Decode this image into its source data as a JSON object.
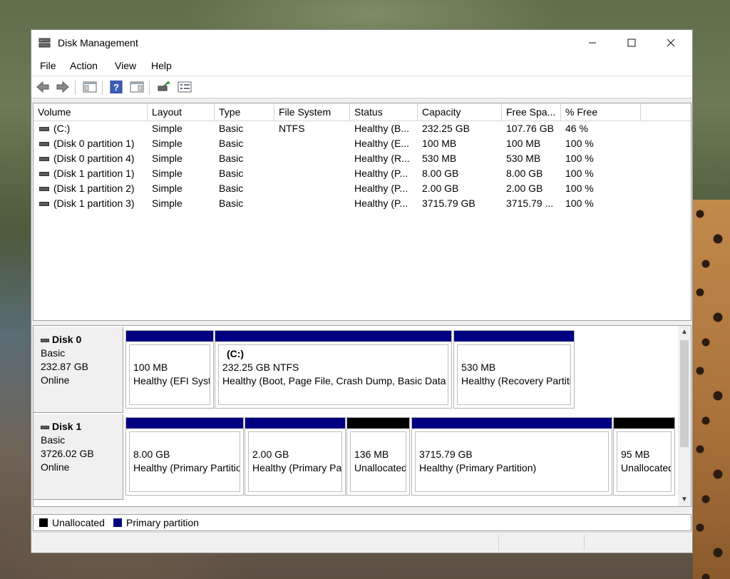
{
  "window": {
    "title": "Disk Management"
  },
  "menu": [
    "File",
    "Action",
    "View",
    "Help"
  ],
  "colors": {
    "primary": "#000080",
    "unallocated": "#000000"
  },
  "columns": [
    "Volume",
    "Layout",
    "Type",
    "File System",
    "Status",
    "Capacity",
    "Free Spa...",
    "% Free"
  ],
  "volumes": [
    {
      "volume": "(C:)",
      "layout": "Simple",
      "type": "Basic",
      "fs": "NTFS",
      "status": "Healthy (B...",
      "capacity": "232.25 GB",
      "free": "107.76 GB",
      "pct": "46 %"
    },
    {
      "volume": "(Disk 0 partition 1)",
      "layout": "Simple",
      "type": "Basic",
      "fs": "",
      "status": "Healthy (E...",
      "capacity": "100 MB",
      "free": "100 MB",
      "pct": "100 %"
    },
    {
      "volume": "(Disk 0 partition 4)",
      "layout": "Simple",
      "type": "Basic",
      "fs": "",
      "status": "Healthy (R...",
      "capacity": "530 MB",
      "free": "530 MB",
      "pct": "100 %"
    },
    {
      "volume": "(Disk 1 partition 1)",
      "layout": "Simple",
      "type": "Basic",
      "fs": "",
      "status": "Healthy (P...",
      "capacity": "8.00 GB",
      "free": "8.00 GB",
      "pct": "100 %"
    },
    {
      "volume": "(Disk 1 partition 2)",
      "layout": "Simple",
      "type": "Basic",
      "fs": "",
      "status": "Healthy (P...",
      "capacity": "2.00 GB",
      "free": "2.00 GB",
      "pct": "100 %"
    },
    {
      "volume": "(Disk 1 partition 3)",
      "layout": "Simple",
      "type": "Basic",
      "fs": "",
      "status": "Healthy (P...",
      "capacity": "3715.79 GB",
      "free": "3715.79 ...",
      "pct": "100 %"
    }
  ],
  "disks": [
    {
      "name": "Disk 0",
      "type": "Basic",
      "size": "232.87 GB",
      "state": "Online",
      "partitions": [
        {
          "name": "",
          "size": "100 MB",
          "status": "Healthy (EFI System Partition)",
          "kind": "primary"
        },
        {
          "name": "(C:)",
          "size": "232.25 GB NTFS",
          "status": "Healthy (Boot, Page File, Crash Dump, Basic Data Partition)",
          "kind": "primary"
        },
        {
          "name": "",
          "size": "530 MB",
          "status": "Healthy (Recovery Partition)",
          "kind": "primary"
        }
      ]
    },
    {
      "name": "Disk 1",
      "type": "Basic",
      "size": "3726.02 GB",
      "state": "Online",
      "partitions": [
        {
          "name": "",
          "size": "8.00 GB",
          "status": "Healthy (Primary Partition)",
          "kind": "primary"
        },
        {
          "name": "",
          "size": "2.00 GB",
          "status": "Healthy (Primary Partition)",
          "kind": "primary"
        },
        {
          "name": "",
          "size": "136 MB",
          "status": "Unallocated",
          "kind": "unallocated"
        },
        {
          "name": "",
          "size": "3715.79 GB",
          "status": "Healthy (Primary Partition)",
          "kind": "primary"
        },
        {
          "name": "",
          "size": "95 MB",
          "status": "Unallocated",
          "kind": "unallocated"
        }
      ]
    }
  ],
  "legend": {
    "unallocated": "Unallocated",
    "primary": "Primary partition"
  },
  "icons": {
    "title": "disk-management-icon",
    "toolbar": [
      "back-arrow-icon",
      "forward-arrow-icon",
      "show-hide-console-tree-icon",
      "help-icon",
      "show-hide-action-pane-icon",
      "connect-disk-icon",
      "properties-icon"
    ]
  }
}
